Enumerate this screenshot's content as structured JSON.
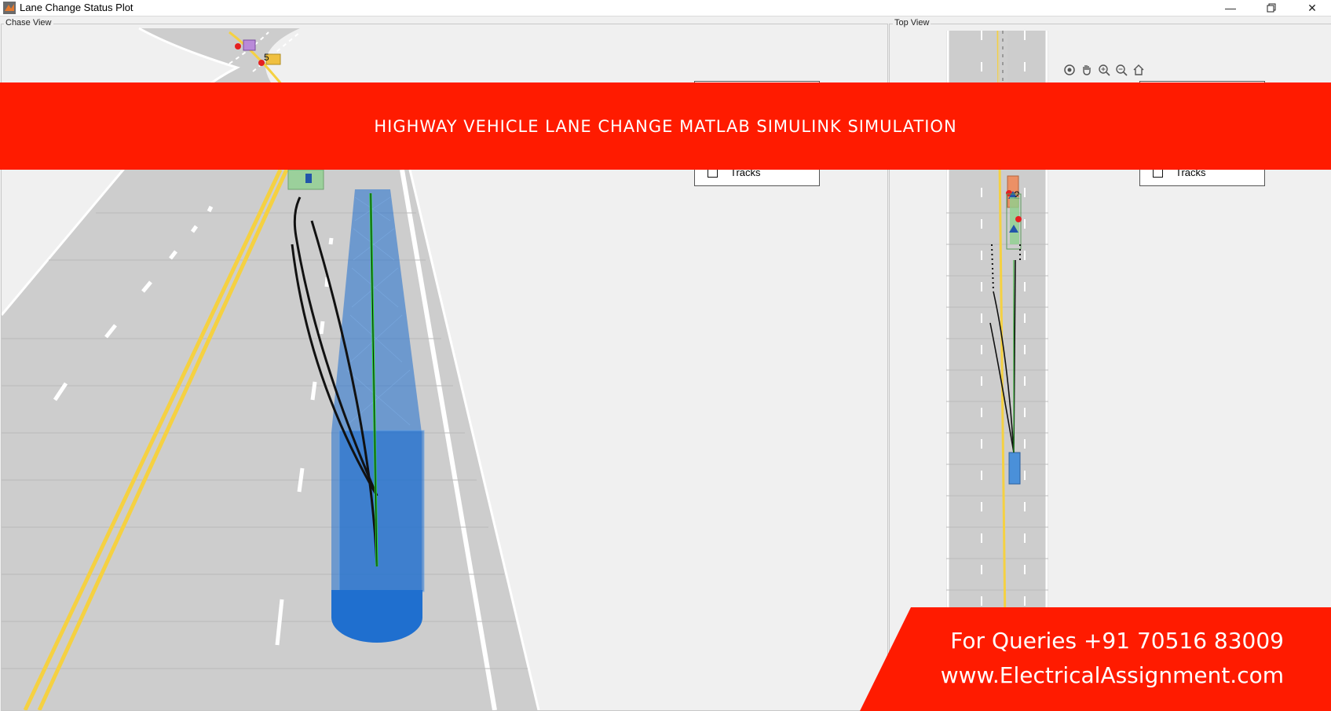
{
  "window": {
    "title": "Lane Change Status Plot",
    "minimize_icon": "minimize-icon",
    "restore_icon": "restore-icon",
    "close_icon": "close-icon"
  },
  "chase_view": {
    "label": "Chase View",
    "legend_tracks": "Tracks",
    "vehicle_id": "5"
  },
  "top_view": {
    "label": "Top View",
    "legend_tracks": "Tracks",
    "vehicle_id": "2",
    "toolbar_icons": [
      "rotate-icon",
      "pan-icon",
      "zoom-in-icon",
      "zoom-out-icon",
      "home-icon"
    ]
  },
  "banner": {
    "text": "HIGHWAY VEHICLE LANE CHANGE MATLAB SIMULINK SIMULATION",
    "color": "#ff1b00"
  },
  "contact": {
    "phone": "For Queries +91 70516 83009",
    "website": "www.ElectricalAssignment.com"
  },
  "colors": {
    "road": "#c8c8c8",
    "lane_yellow": "#f5d142",
    "ego_blue": "#1f6fcf",
    "path_green": "#22dd22"
  }
}
